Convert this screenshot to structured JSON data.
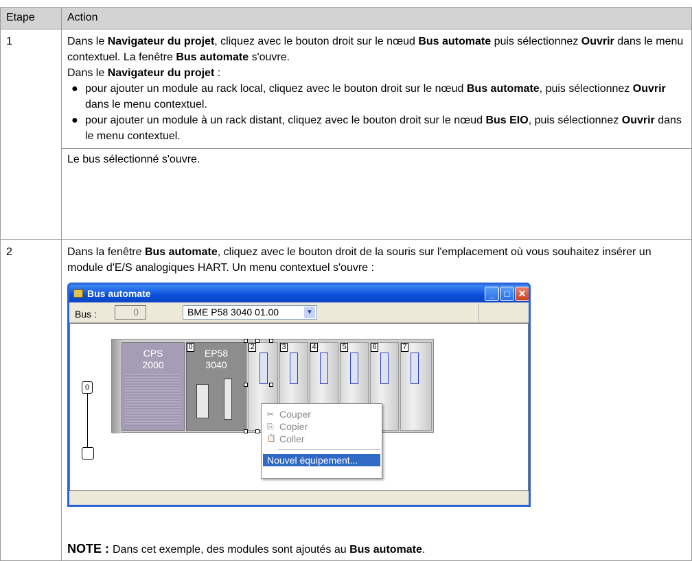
{
  "table": {
    "headers": [
      "Etape",
      "Action"
    ],
    "rows": [
      {
        "step": "1",
        "p1": [
          {
            "t": "Dans le "
          },
          {
            "t": "Navigateur du projet",
            "b": true
          },
          {
            "t": ", cliquez avec le bouton droit sur le nœud "
          },
          {
            "t": "Bus automate",
            "b": true
          },
          {
            "t": " puis sélectionnez "
          },
          {
            "t": "Ouvrir",
            "b": true
          },
          {
            "t": " dans le menu contextuel. La fenêtre "
          },
          {
            "t": "Bus automate",
            "b": true
          },
          {
            "t": " s'ouvre."
          }
        ],
        "p2": [
          {
            "t": "Dans le "
          },
          {
            "t": "Navigateur du projet",
            "b": true
          },
          {
            "t": " :"
          }
        ],
        "bullets": [
          [
            {
              "t": "pour ajouter un module au rack local, cliquez avec le bouton droit sur le nœud "
            },
            {
              "t": "Bus automate",
              "b": true
            },
            {
              "t": ", puis sélectionnez "
            },
            {
              "t": "Ouvrir",
              "b": true
            },
            {
              "t": " dans le menu contextuel."
            }
          ],
          [
            {
              "t": "pour ajouter un module à un rack distant, cliquez avec le bouton droit sur le nœud "
            },
            {
              "t": "Bus EIO",
              "b": true
            },
            {
              "t": ", puis sélectionnez "
            },
            {
              "t": "Ouvrir",
              "b": true
            },
            {
              "t": " dans le menu contextuel."
            }
          ]
        ],
        "result": "Le bus sélectionné s'ouvre."
      },
      {
        "step": "2",
        "p1": [
          {
            "t": "Dans la fenêtre "
          },
          {
            "t": "Bus automate",
            "b": true
          },
          {
            "t": ", cliquez avec le bouton droit de la souris sur l'emplacement où vous souhaitez insérer un module d'E/S analogiques HART. Un menu contextuel s'ouvre :"
          }
        ],
        "note": [
          {
            "t": "NOTE : ",
            "b": true,
            "big": true
          },
          {
            "t": "Dans cet exemple, des modules sont ajoutés au "
          },
          {
            "t": "Bus automate",
            "b": true
          },
          {
            "t": "."
          }
        ]
      }
    ]
  },
  "window": {
    "title": "Bus automate",
    "controls": [
      "_",
      "□",
      "✕"
    ],
    "bus_label": "Bus :",
    "bus_number": "0",
    "rack_select": "BME P58 3040 01.00",
    "bus_node": "0",
    "modules": {
      "cps": {
        "line1": "CPS",
        "line2": "2000"
      },
      "cpu": {
        "num": "0",
        "line1": "EP58",
        "line2": "3040"
      },
      "slots": [
        "2",
        "3",
        "4",
        "5",
        "6",
        "7"
      ]
    },
    "context_menu": [
      {
        "label": "Couper",
        "icon": "scissors-icon",
        "glyph": "✂"
      },
      {
        "label": "Copier",
        "icon": "copy-icon",
        "glyph": "⎘"
      },
      {
        "label": "Coller",
        "icon": "paste-icon",
        "glyph": "📋"
      }
    ],
    "context_menu_new": "Nouvel équipement..."
  }
}
